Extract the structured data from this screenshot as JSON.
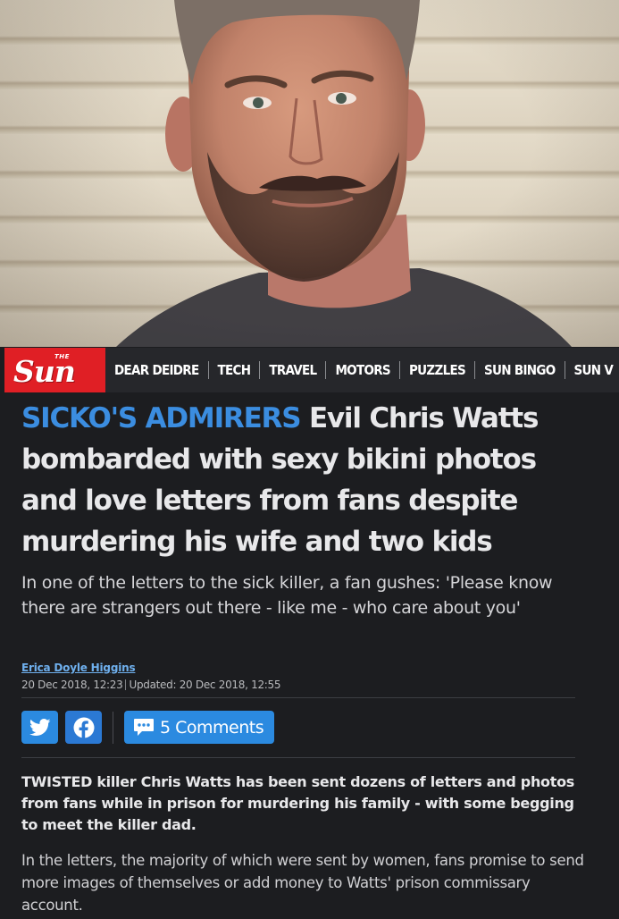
{
  "nav": {
    "logo_small": "THE",
    "logo": "Sun",
    "items": [
      "DEAR DEIDRE",
      "TECH",
      "TRAVEL",
      "MOTORS",
      "PUZZLES",
      "SUN BINGO",
      "SUN V"
    ]
  },
  "article": {
    "kicker": "SICKO'S ADMIRERS",
    "headline": " Evil Chris Watts bombarded with sexy bikini photos and love letters from fans despite murdering his wife and two kids",
    "standfirst": "In one of the letters to the sick killer, a fan gushes: 'Please know there are strangers out there - like me - who care about you'",
    "author": "Erica Doyle Higgins",
    "published": "20 Dec 2018, 12:23",
    "updated": "Updated: 20 Dec 2018, 12:55",
    "comments_label": "5 Comments",
    "lead": "TWISTED killer Chris Watts has been sent dozens of letters and photos from fans while in prison for murdering his family - with some begging to meet the killer dad.",
    "paragraph": "In the letters, the majority of which were sent by women, fans promise to send more images of themselves or add money to Watts' prison commissary account."
  },
  "colors": {
    "brand_red": "#e01f25",
    "kicker_blue": "#3b8de0",
    "page_bg": "#1c1d20",
    "nav_bg": "#26272b",
    "button_blue": "#2b8ae0"
  },
  "icons": {
    "twitter": "twitter-icon",
    "facebook": "facebook-icon",
    "comments": "speech-bubble-icon"
  }
}
